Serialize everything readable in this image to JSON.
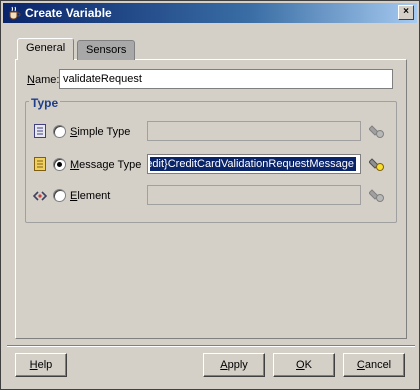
{
  "window": {
    "title": "Create Variable",
    "close_glyph": "×"
  },
  "tabs": [
    {
      "label": "General",
      "active": true
    },
    {
      "label": "Sensors",
      "active": false
    }
  ],
  "name": {
    "label_mnemonic": "N",
    "label_rest": "ame:",
    "value": "validateRequest"
  },
  "type_group": {
    "legend": "Type",
    "options": [
      {
        "mnemonic": "S",
        "rest": "imple Type",
        "value": "",
        "selected": false,
        "icon": "simple-type-icon"
      },
      {
        "mnemonic": "M",
        "rest": "essage Type",
        "value": "{http://www.globalcompany.com/ns/OrderBooking}ValidateCreditCard}CreditCardValidationRequestMessage",
        "shown_value": "redit}CreditCardValidationRequestMessage",
        "selected": true,
        "icon": "message-type-icon"
      },
      {
        "mnemonic": "E",
        "rest": "lement",
        "value": "",
        "selected": false,
        "icon": "element-icon"
      }
    ]
  },
  "buttons": {
    "help": {
      "mnemonic": "H",
      "rest": "elp"
    },
    "apply": {
      "mnemonic": "A",
      "rest": "pply"
    },
    "ok": {
      "mnemonic": "O",
      "rest": "K"
    },
    "cancel": {
      "mnemonic": "C",
      "rest": "ancel"
    }
  },
  "colors": {
    "title_bar_start": "#0a246a",
    "selection": "#0a246a",
    "legend_text": "#1f3e8a",
    "window_bg": "#d4d0c8"
  }
}
